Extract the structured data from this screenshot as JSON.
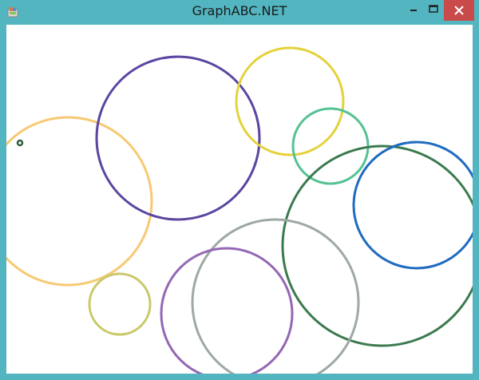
{
  "window": {
    "title": "GraphABC.NET",
    "frame_color": "#52b5c0",
    "close_button_color": "#c94a4a",
    "icons": [
      "app-icon",
      "minimize-icon",
      "maximize-icon",
      "close-icon"
    ]
  },
  "canvas": {
    "background": "#ffffff",
    "circles": [
      {
        "name": "circle-orange",
        "color": "#f7c972"
      },
      {
        "name": "circle-indigo",
        "color": "#5b45a1"
      },
      {
        "name": "circle-yellow",
        "color": "#e4d23b"
      },
      {
        "name": "circle-mint",
        "color": "#55c293"
      },
      {
        "name": "circle-dark-green",
        "color": "#3b7a4e"
      },
      {
        "name": "circle-blue",
        "color": "#1f6bc0"
      },
      {
        "name": "circle-gray",
        "color": "#9ea8a4"
      },
      {
        "name": "circle-purple",
        "color": "#9467b4"
      },
      {
        "name": "circle-olive",
        "color": "#c9c86b"
      },
      {
        "name": "circle-small-dot",
        "color": "#2e5e3c"
      }
    ]
  }
}
